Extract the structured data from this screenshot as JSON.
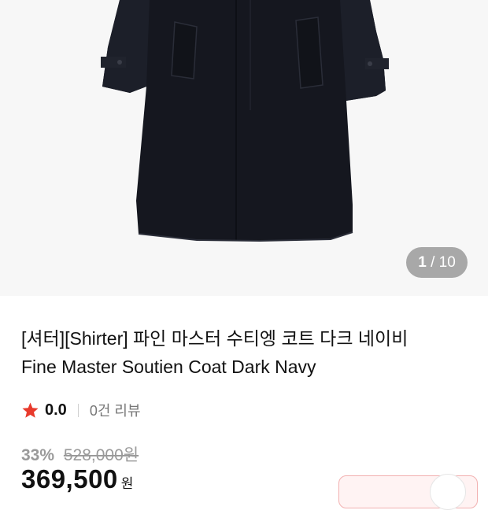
{
  "gallery": {
    "current": "1",
    "separator": " / ",
    "total": "10"
  },
  "product": {
    "title_ko": "[셔터][Shirter] 파인 마스터 수티엥 코트 다크 네이비",
    "title_en": "Fine Master Soutien Coat Dark Navy",
    "rating": "0.0",
    "review_count": "0건 리뷰",
    "discount": "33%",
    "original_price": "528,000원",
    "price": "369,500",
    "currency": "원"
  },
  "colors": {
    "star": "#e83a2c",
    "coat": "#15171f",
    "coupon_border": "#f2b1b1"
  },
  "icons": {
    "star": "star-icon"
  }
}
